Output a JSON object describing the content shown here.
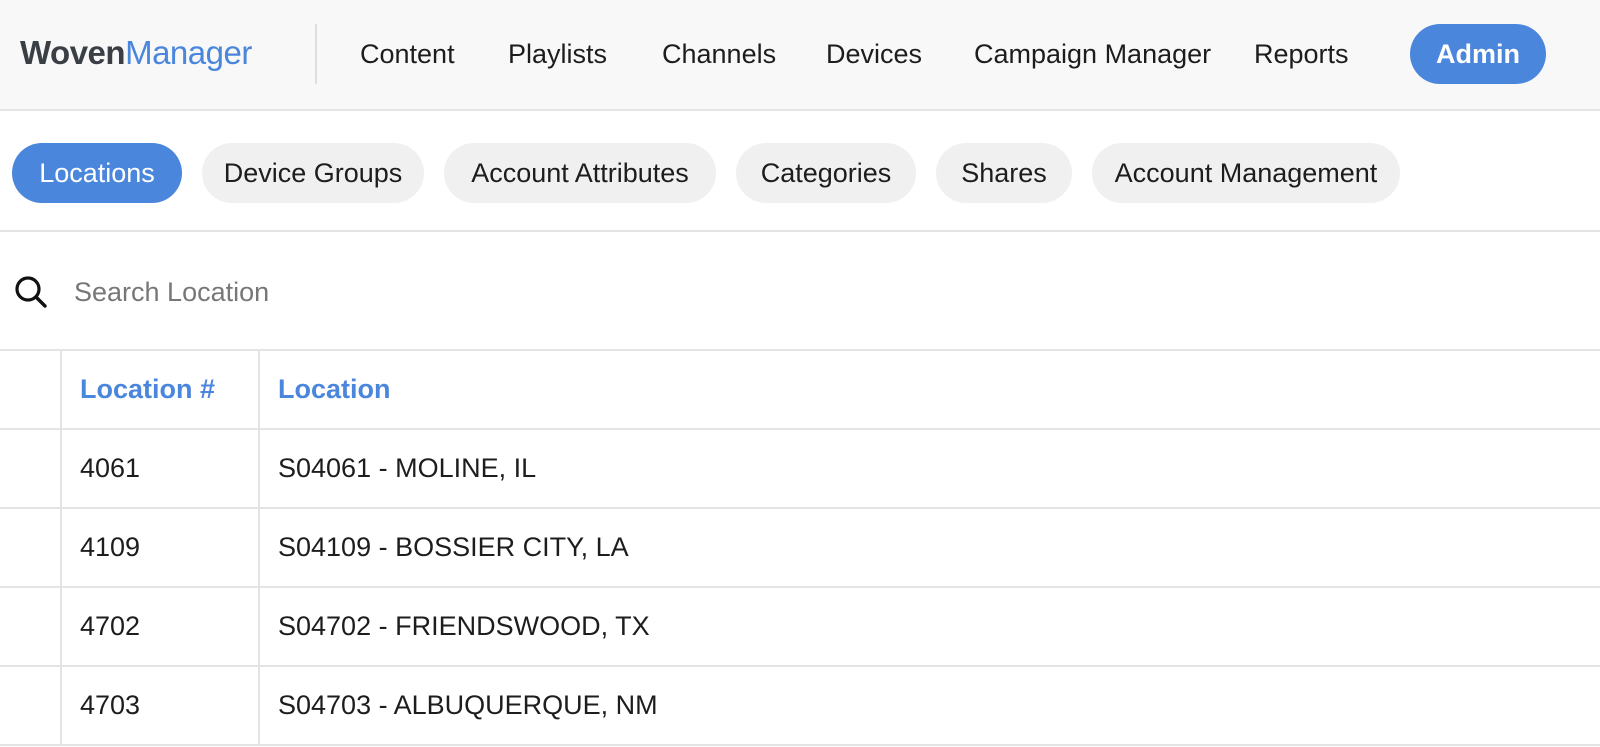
{
  "brand": {
    "logo_part1": "Woven",
    "logo_part2": "Manager"
  },
  "nav": {
    "links": [
      "Content",
      "Playlists",
      "Channels",
      "Devices",
      "Campaign Manager",
      "Reports"
    ],
    "admin_label": "Admin"
  },
  "subnav": {
    "tabs": [
      "Locations",
      "Device Groups",
      "Account Attributes",
      "Categories",
      "Shares",
      "Account Management"
    ],
    "active": "Locations"
  },
  "search": {
    "placeholder": "Search Location",
    "value": ""
  },
  "table": {
    "columns": [
      "Location #",
      "Location"
    ],
    "rows": [
      {
        "number": "4061",
        "location": "S04061 - MOLINE, IL"
      },
      {
        "number": "4109",
        "location": "S04109 - BOSSIER CITY, LA"
      },
      {
        "number": "4702",
        "location": "S04702 - FRIENDSWOOD, TX"
      },
      {
        "number": "4703",
        "location": "S04703 - ALBUQUERQUE, NM"
      }
    ]
  },
  "colors": {
    "accent": "#4a86db",
    "pill_bg": "#f0f0f0",
    "border": "#e4e4e4"
  },
  "icons": {
    "search": "search-icon"
  }
}
